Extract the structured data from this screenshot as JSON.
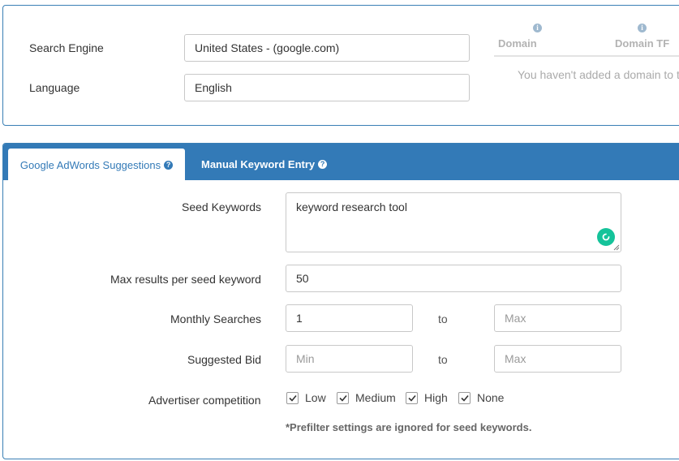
{
  "top": {
    "search_engine_label": "Search Engine",
    "search_engine_value": "United States - (google.com)",
    "language_label": "Language",
    "language_value": "English",
    "domain_table": {
      "columns": [
        "Domain",
        "Domain TF"
      ],
      "info_icon": "info-icon",
      "empty_message": "You haven't added a domain to t"
    }
  },
  "tabs": {
    "active": "Google AdWords Suggestions",
    "other": "Manual Keyword Entry",
    "help_icon": "question-circle-icon"
  },
  "form": {
    "seed_keywords_label": "Seed Keywords",
    "seed_keywords_value": "keyword research tool",
    "max_results_label": "Max results per seed keyword",
    "max_results_value": "50",
    "monthly_searches_label": "Monthly Searches",
    "monthly_min_value": "1",
    "monthly_max_placeholder": "Max",
    "suggested_bid_label": "Suggested Bid",
    "bid_min_placeholder": "Min",
    "bid_max_placeholder": "Max",
    "to_label": "to",
    "competition_label": "Advertiser competition",
    "competition_options": [
      {
        "label": "Low",
        "checked": true
      },
      {
        "label": "Medium",
        "checked": true
      },
      {
        "label": "High",
        "checked": true
      },
      {
        "label": "None",
        "checked": true
      }
    ],
    "note": "*Prefilter settings are ignored for seed keywords."
  }
}
